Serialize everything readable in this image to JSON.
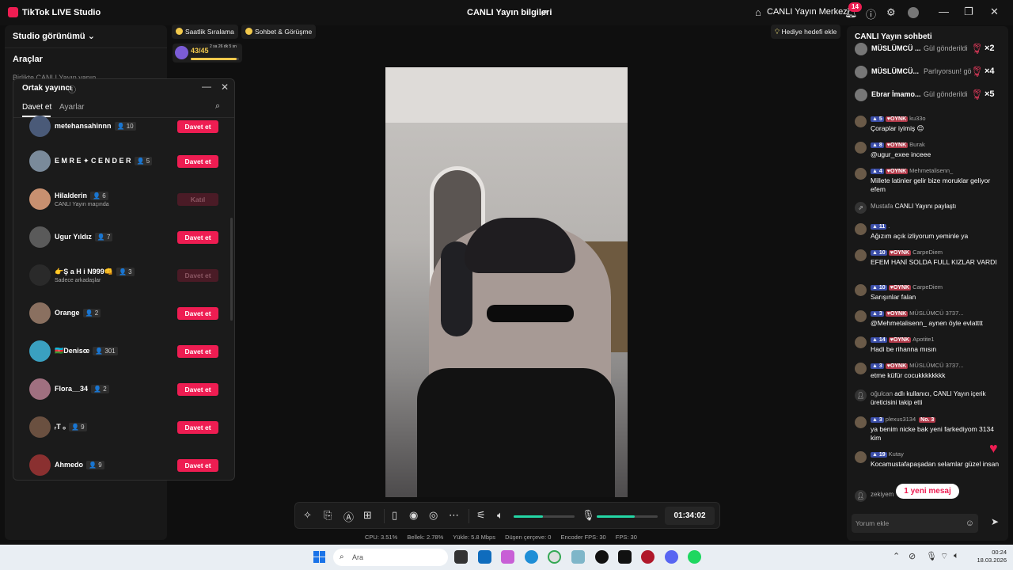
{
  "window": {
    "app_title": "TikTok LIVE Studio",
    "center_title": "CANLI Yayın bilgileri",
    "live_center_label": "CANLI Yayın Merkezi",
    "notification_count": "14",
    "icons": [
      "share-icon",
      "home-icon",
      "bell-icon",
      "help-icon",
      "settings-icon",
      "avatar",
      "minimize-icon",
      "maximize-icon",
      "close-icon"
    ]
  },
  "left_panel": {
    "studio_view_label": "Studio görünümü",
    "tools_label": "Araçlar",
    "together_label": "Birlikte CANLI Yayın yapın"
  },
  "cohost": {
    "title": "Ortak yayıncı",
    "tabs": [
      "Davet et",
      "Ayarlar"
    ],
    "active_tab": "Davet et",
    "rows": [
      {
        "name": "metehansahinnn",
        "count": "10",
        "sub": "",
        "button": "Davet et",
        "enabled": true,
        "avatar_color": "#4a5a78"
      },
      {
        "name": "E M R E ✦ C E N D E R",
        "count": "5",
        "sub": "",
        "button": "Davet et",
        "enabled": true,
        "avatar_color": "#7a8a9a"
      },
      {
        "name": "Hilalderin",
        "count": "6",
        "sub": "CANLI Yayın maçında",
        "button": "Katıl",
        "enabled": false,
        "avatar_color": "#c89070"
      },
      {
        "name": "Ugur Yıldız",
        "count": "7",
        "sub": "",
        "button": "Davet et",
        "enabled": true,
        "avatar_color": "#5a5a5a"
      },
      {
        "name": "👉Ş a H i N999👊",
        "count": "3",
        "sub": "Sadece arkadaşlar",
        "button": "Davet et",
        "enabled": false,
        "avatar_color": "#2a2a2a"
      },
      {
        "name": "Orange",
        "count": "2",
        "sub": "",
        "button": "Davet et",
        "enabled": true,
        "avatar_color": "#8a7060"
      },
      {
        "name": "🇦🇿Denisœ",
        "count": "301",
        "sub": "",
        "button": "Davet et",
        "enabled": true,
        "avatar_color": "#3aa0c0"
      },
      {
        "name": "Flora__34",
        "count": "2",
        "sub": "",
        "button": "Davet et",
        "enabled": true,
        "avatar_color": "#a07080"
      },
      {
        "name": "ᵣT ₒ",
        "count": "9",
        "sub": "",
        "button": "Davet et",
        "enabled": true,
        "avatar_color": "#6a5040"
      },
      {
        "name": "Ahmedo",
        "count": "9",
        "sub": "",
        "button": "Davet et",
        "enabled": true,
        "avatar_color": "#8a3030"
      }
    ]
  },
  "top_chips": {
    "hourly_ranking": "Saatlik Sıralama",
    "chat_meeting": "Sohbet & Görüşme",
    "add_gift_goal": "Hediye hedefi ekle"
  },
  "goal": {
    "value": "43/45",
    "timer": "2 sa 26 dk 5 sn",
    "progress": 0.955
  },
  "controls": {
    "timer": "01:34:02",
    "speaker_volume": 0.48,
    "mic_volume": 0.62
  },
  "stats": {
    "cpu": "CPU:  3.51%",
    "memory": "Bellek:  2.78%",
    "upload": "Yükle:  5.8 Mbps",
    "dropped": "Düşen çerçeve:  0",
    "encoder_fps": "Encoder FPS:  30",
    "fps": "FPS:  30"
  },
  "chat": {
    "title": "CANLI Yayın sohbeti",
    "gifts": [
      {
        "user": "MÜSLÜMCÜ ...",
        "text": "Gül gönderildi",
        "mult": "×2"
      },
      {
        "user": "MÜSLÜMCÜ...",
        "text": "Parlıyorsun! gö",
        "mult": "×4"
      },
      {
        "user": "Ebrar İmamo...",
        "text": "Gül gönderildi",
        "mult": "×5"
      }
    ],
    "messages": [
      {
        "level": "5",
        "fan": "OYNK",
        "user": "ku33o",
        "text": "Çoraplar iyimiş 😊"
      },
      {
        "level": "8",
        "fan": "OYNK",
        "user": "Burak",
        "text": "@ugur_exee inceee"
      },
      {
        "level": "4",
        "fan": "OYNK",
        "user": "Mehmetalisenn_",
        "text": "Millete latinler gelir bize moruklar geliyor efem"
      },
      {
        "system": true,
        "user": "Mustafa",
        "text": "CANLI Yayını paylaştı"
      },
      {
        "level": "11",
        "fan": "",
        "user": ".",
        "text": "Ağızım açık izliyorum yeminle ya"
      },
      {
        "level": "10",
        "fan": "OYNK",
        "user": "CarpeDiem",
        "text": "EFEM HANİ SOLDA FULL KIZLAR VARDI"
      },
      {
        "level": "10",
        "fan": "OYNK",
        "user": "CarpeDiem",
        "text": "Sarışınlar falan"
      },
      {
        "level": "3",
        "fan": "OYNK",
        "user": "MÜSLÜMCÜ 3737...",
        "text": "@Mehmetalisenn_ aynen öyle evlatttt"
      },
      {
        "level": "14",
        "fan": "OYNK",
        "user": "Apotite1",
        "text": "Hadi be rihanna mısın"
      },
      {
        "level": "3",
        "fan": "OYNK",
        "user": "MÜSLÜMCÜ 3737...",
        "text": "etme küfür cocukkkkkkkk"
      },
      {
        "system": true,
        "user": "oğulcan",
        "text": "adlı kullanıcı, CANLI Yayın içerik üreticisini takip etti"
      },
      {
        "level": "3",
        "fan": "",
        "user": "plexus3134",
        "rank": "No. 3",
        "text": "ya benim nicke bak yeni farkediyom 3134 kim"
      },
      {
        "level": "19",
        "fan": "",
        "user": "Kutay",
        "text": "Kocamustafapaşadan selamlar güzel insan"
      },
      {
        "system": true,
        "user": "zekiyem",
        "text": ""
      }
    ],
    "new_message_pill": "1 yeni mesaj",
    "comment_placeholder": "Yorum ekle"
  },
  "taskbar": {
    "search_placeholder": "Ara",
    "time": "00:24",
    "date": "18.03.2026"
  }
}
